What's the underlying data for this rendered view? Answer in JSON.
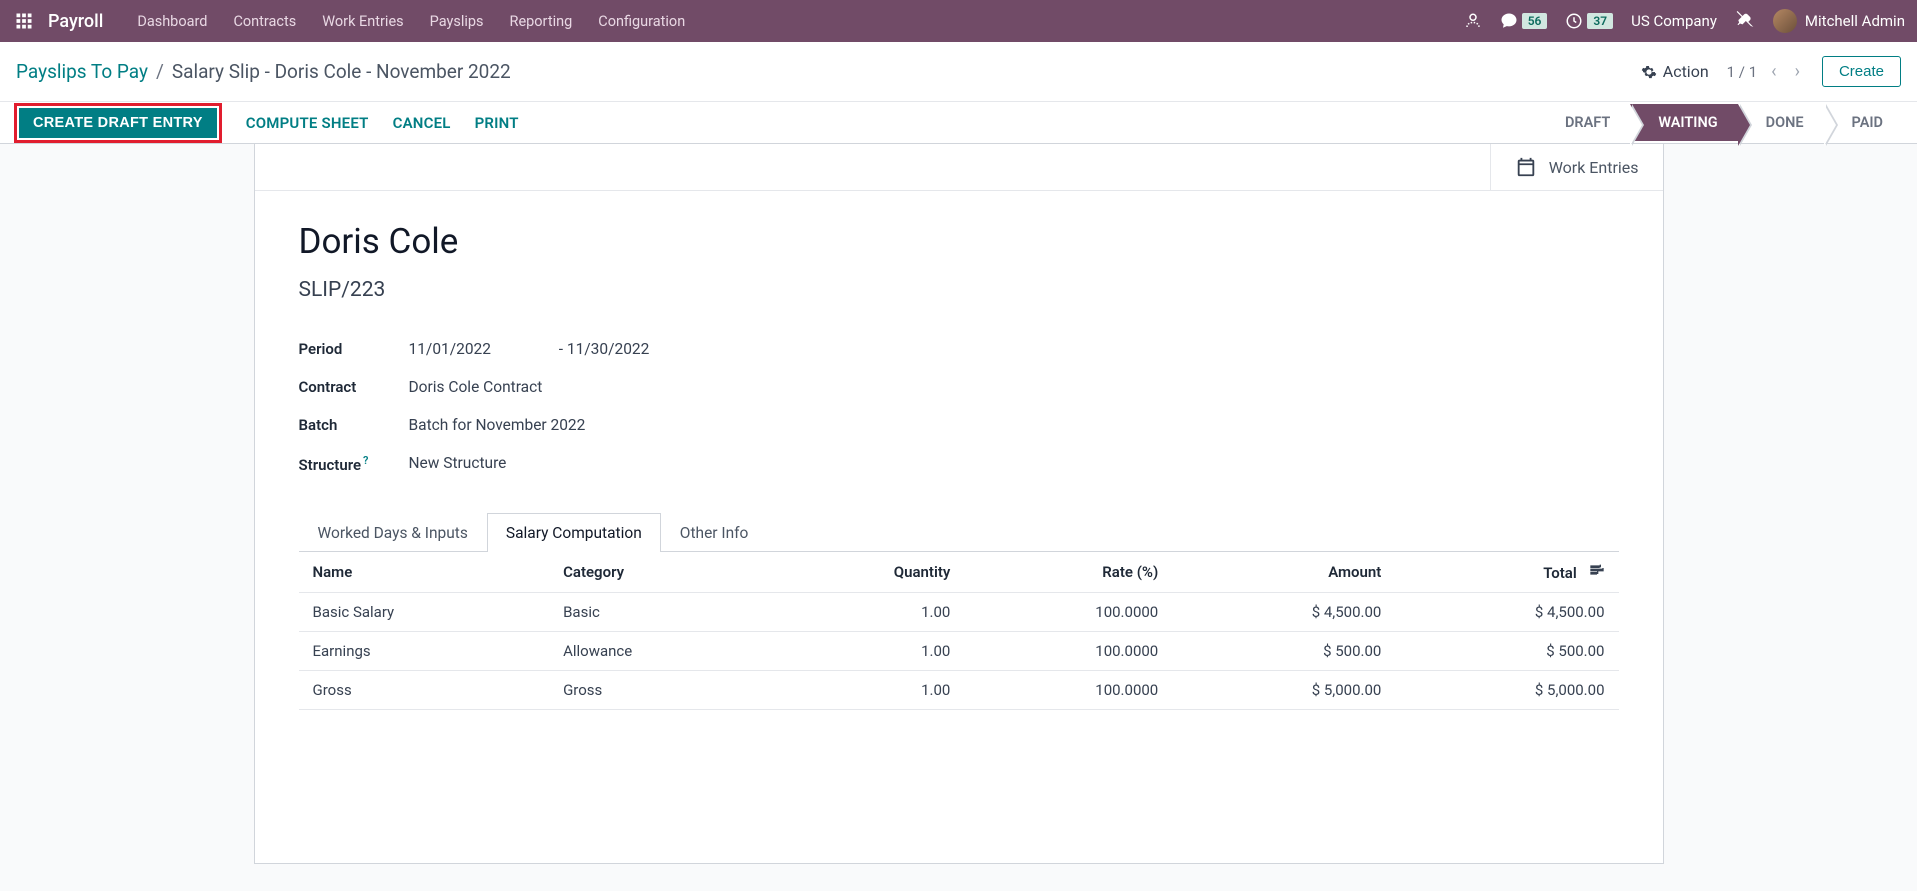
{
  "app_name": "Payroll",
  "nav": [
    "Dashboard",
    "Contracts",
    "Work Entries",
    "Payslips",
    "Reporting",
    "Configuration"
  ],
  "badges": {
    "messages": "56",
    "activities": "37"
  },
  "company": "US Company",
  "user": "Mitchell Admin",
  "breadcrumb": {
    "parent": "Payslips To Pay",
    "current": "Salary Slip - Doris Cole - November 2022"
  },
  "page_actions": {
    "action_label": "Action",
    "pager": "1 / 1",
    "create": "Create"
  },
  "buttons": {
    "create_draft": "CREATE DRAFT ENTRY",
    "compute": "COMPUTE SHEET",
    "cancel": "CANCEL",
    "print": "PRINT"
  },
  "status_steps": [
    "DRAFT",
    "WAITING",
    "DONE",
    "PAID"
  ],
  "status_active": "WAITING",
  "stat_button": "Work Entries",
  "record": {
    "title": "Doris Cole",
    "number": "SLIP/223",
    "fields": {
      "period_label": "Period",
      "period_from": "11/01/2022",
      "period_sep": "-",
      "period_to": "11/30/2022",
      "contract_label": "Contract",
      "contract_value": "Doris Cole Contract",
      "batch_label": "Batch",
      "batch_value": "Batch for November 2022",
      "structure_label": "Structure",
      "structure_value": "New Structure"
    }
  },
  "tabs": [
    "Worked Days & Inputs",
    "Salary Computation",
    "Other Info"
  ],
  "tab_active": "Salary Computation",
  "table": {
    "headers": [
      "Name",
      "Category",
      "Quantity",
      "Rate (%)",
      "Amount",
      "Total"
    ],
    "rows": [
      {
        "name": "Basic Salary",
        "category": "Basic",
        "quantity": "1.00",
        "rate": "100.0000",
        "amount": "$ 4,500.00",
        "total": "$ 4,500.00"
      },
      {
        "name": "Earnings",
        "category": "Allowance",
        "quantity": "1.00",
        "rate": "100.0000",
        "amount": "$ 500.00",
        "total": "$ 500.00"
      },
      {
        "name": "Gross",
        "category": "Gross",
        "quantity": "1.00",
        "rate": "100.0000",
        "amount": "$ 5,000.00",
        "total": "$ 5,000.00"
      }
    ]
  }
}
